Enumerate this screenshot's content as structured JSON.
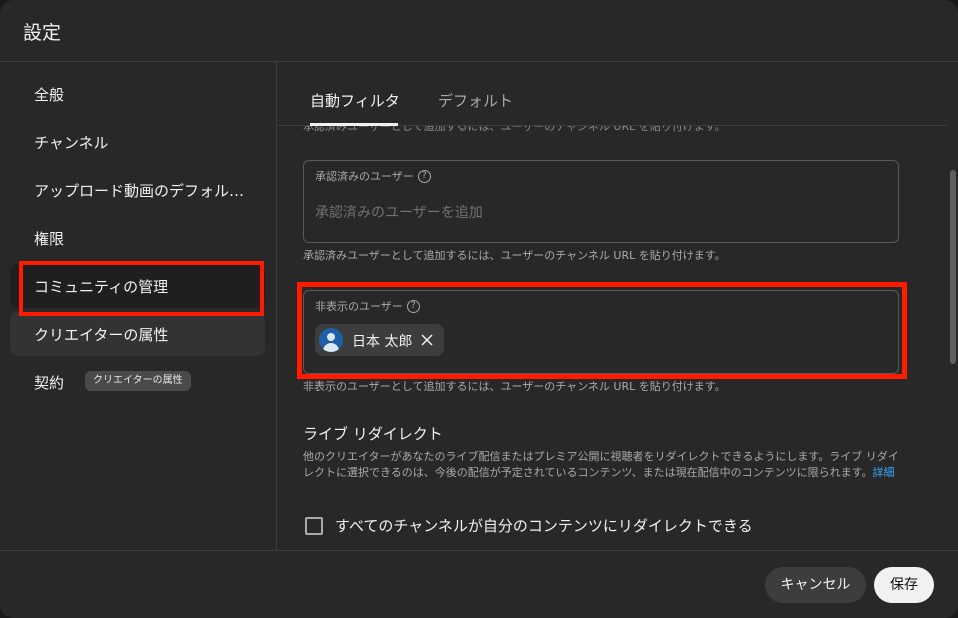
{
  "dialog": {
    "title": "設定"
  },
  "sidebar": {
    "items": [
      {
        "label": "全般"
      },
      {
        "label": "チャンネル"
      },
      {
        "label": "アップロード動画のデフォル…"
      },
      {
        "label": "権限"
      },
      {
        "label": "コミュニティの管理"
      },
      {
        "label": "クリエイターの属性"
      },
      {
        "label": "契約",
        "badge": "クリエイターの属性"
      }
    ]
  },
  "tabs": [
    {
      "label": "自動フィルタ"
    },
    {
      "label": "デフォルト"
    }
  ],
  "content": {
    "cut_off_text": "承認済みユーザーとして追加するには、ユーザーのチャンネル URL を貼り付けます。",
    "approved_users": {
      "label": "承認済みのユーザー",
      "placeholder": "承認済みのユーザーを追加",
      "helper": "承認済みユーザーとして追加するには、ユーザーのチャンネル URL を貼り付けます。"
    },
    "hidden_users": {
      "label": "非表示のユーザー",
      "chip_label": "日本 太郎",
      "helper": "非表示のユーザーとして追加するには、ユーザーのチャンネル URL を貼り付けます。"
    },
    "live_redirect": {
      "title": "ライブ リダイレクト",
      "description": "他のクリエイターがあなたのライブ配信またはプレミア公開に視聴者をリダイレクトできるようにします。ライブ リダイレクトに選択できるのは、今後の配信が予定されているコンテンツ、または現在配信中のコンテンツに限られます。",
      "link": "詳細",
      "checkbox_label": "すべてのチャンネルが自分のコンテンツにリダイレクトできる",
      "checkbox_checked": false
    }
  },
  "footer": {
    "cancel_label": "キャンセル",
    "save_label": "保存"
  },
  "colors": {
    "highlight": "#ff1a00",
    "link": "#3ea6ff",
    "background": "#282828"
  }
}
